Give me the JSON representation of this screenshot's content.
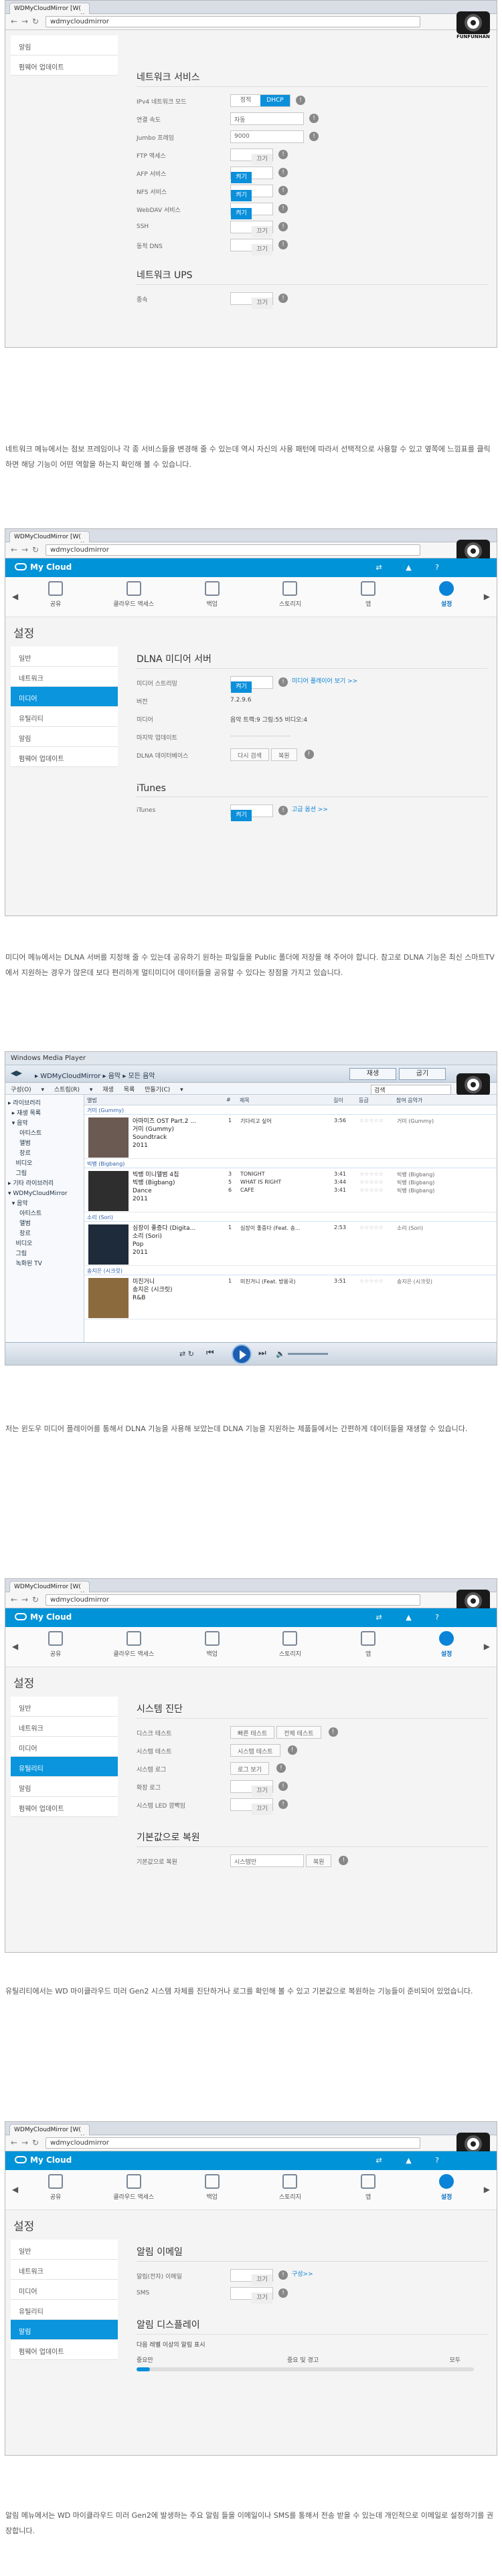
{
  "browser": {
    "tab_title": "WDMyCloudMirror [W(",
    "tab_title_full": "WDMyCloudMirror",
    "url": "wdmycloudmirror",
    "camera_brand": "FUNFUNHAN"
  },
  "shot1": {
    "sidebar": [
      "알림",
      "펌웨어 업데이트"
    ],
    "section_title": "네트워크 서비스",
    "rows": [
      {
        "label": "IPv4 네트워크 모드",
        "type": "seg",
        "a": "정적",
        "b": "DHCP"
      },
      {
        "label": "연결 속도",
        "type": "select",
        "value": "자동"
      },
      {
        "label": "Jumbo 프레임",
        "type": "select",
        "value": "9000"
      },
      {
        "label": "FTP 액세스",
        "type": "toggle",
        "state": "off"
      },
      {
        "label": "AFP 서비스",
        "type": "toggle",
        "state": "on"
      },
      {
        "label": "NFS 서비스",
        "type": "toggle",
        "state": "on"
      },
      {
        "label": "WebDAV 서비스",
        "type": "toggle",
        "state": "on"
      },
      {
        "label": "SSH",
        "type": "toggle",
        "state": "off"
      },
      {
        "label": "동적 DNS",
        "type": "toggle",
        "state": "off"
      }
    ],
    "ups_title": "네트워크 UPS",
    "ups_row": {
      "label": "종속",
      "state": "off"
    }
  },
  "toggle": {
    "on": "켜기",
    "off": "끄기"
  },
  "para1": "네트워크 메뉴에서는 점보 프레임이나 각 종 서비스들을 변경해 줄 수 있는데 역시 자신의 사용 패턴에 따라서 선택적으로 사용할 수 있고 옆쪽에 느낌표를 클릭하면 해당 기능이 어떤 역할을 하는지 확인해 볼 수 있습니다.",
  "wd": {
    "logo": "My Cloud",
    "nav": [
      "공유",
      "클라우드 액세스",
      "백업",
      "스토리지",
      "앱",
      "설정"
    ],
    "page_title": "설정",
    "sidebar": [
      "일반",
      "네트워크",
      "미디어",
      "유틸리티",
      "알림",
      "펌웨어 업데이트"
    ]
  },
  "shot2": {
    "section_title": "DLNA 미디어 서버",
    "rows": [
      {
        "label": "미디어 스트리밍",
        "kind": "toggle_link",
        "link": "미디어 플레이어 보기 >>"
      },
      {
        "label": "버전",
        "kind": "text",
        "value": "7.2.9.6"
      },
      {
        "label": "미디어",
        "kind": "text",
        "value": "음악 트랙:9   그림:55   비디오:4"
      },
      {
        "label": "마지막 업데이트",
        "kind": "text",
        "value": "——————————"
      },
      {
        "label": "DLNA 데이터베이스",
        "kind": "buttons",
        "b1": "다시 검색",
        "b2": "복원"
      }
    ],
    "itunes_title": "iTunes",
    "itunes_row": {
      "label": "iTunes",
      "link": "고급 옵션 >>"
    }
  },
  "para2": "미디어 메뉴에서는 DLNA 서버를 지정해 줄 수 있는데 공유하기 원하는 파일들을 Public 폴더에 저장을 해 주어야 합니다. 참고로 DLNA 기능은 최신 스마트TV에서 지원하는 경우가 많은데 보다 편리하게 멀티미디어 데이터들을 공유할 수 있다는 장점을 가지고 있습니다.",
  "wmp": {
    "title": "Windows Media Player",
    "breadcrumb": "▸ WDMyCloudMirror ▸ 음악 ▸ 모든 음악",
    "btn_play": "재생",
    "btn_sync": "굽기",
    "menu": "구성(O) ▾  스트림(R) ▾  재생 목록 만들기(C) ▾",
    "search": "검색",
    "tree": [
      "▸ 라이브러리",
      "  ▸ 재생 목록",
      "  ▾ 음악",
      "      아티스트",
      "      앨범",
      "      장르",
      "    비디오",
      "    그림",
      "▸ 기타 라이브러리",
      "▾ WDMyCloudMirror",
      "  ▾ 음악",
      "      아티스트",
      "      앨범",
      "      장르",
      "    비디오",
      "    그림",
      "    녹화된 TV"
    ],
    "cols": [
      "앨범",
      "#",
      "제목",
      "길이",
      "등급",
      "참여 음악가"
    ],
    "groups": [
      {
        "head": "거미 (Gummy)",
        "meta": [
          "아마미즈 OST Part.2 ...",
          "거미 (Gummy)",
          "Soundtrack",
          "2011"
        ],
        "tracks": [
          {
            "n": "1",
            "t": "기다리고 싶어",
            "len": "3:56",
            "art": "거미 (Gummy)"
          }
        ]
      },
      {
        "head": "빅뱅 (Bigbang)",
        "meta": [
          "빅뱅 미니앨범 4집",
          "빅뱅 (Bigbang)",
          "Dance",
          "2011"
        ],
        "tracks": [
          {
            "n": "3",
            "t": "TONIGHT",
            "len": "3:41",
            "art": "빅뱅 (Bigbang)"
          },
          {
            "n": "5",
            "t": "WHAT IS RIGHT",
            "len": "3:44",
            "art": "빅뱅 (Bigbang)"
          },
          {
            "n": "6",
            "t": "CAFE",
            "len": "3:41",
            "art": "빅뱅 (Bigbang)"
          }
        ]
      },
      {
        "head": "소리 (Sori)",
        "meta": [
          "심장이 좋증다 (Digita...",
          "소리 (Sori)",
          "Pop",
          "2011"
        ],
        "tracks": [
          {
            "n": "1",
            "t": "심장이 좋증다 (Feat. 송...",
            "len": "2:53",
            "art": "소리 (Sori)"
          }
        ]
      },
      {
        "head": "송지은 (시크릿)",
        "meta": [
          "미친거니",
          "송지은 (시크릿)",
          "R&B",
          ""
        ],
        "tracks": [
          {
            "n": "1",
            "t": "미친거니 (Feat. 방용국)",
            "len": "3:51",
            "art": "송지은 (시크릿)"
          }
        ]
      }
    ]
  },
  "para3": "저는 윈도우 미디어 플레이어를 통해서 DLNA 기능을 사용해 보았는데 DLNA 기능을 지원하는 제품들에서는 간편하게 데이터들을 재생할 수 있습니다.",
  "shot3": {
    "section_title": "시스템 진단",
    "rows": [
      {
        "label": "디스크 테스트",
        "b": [
          "빠른 테스트",
          "전체 테스트"
        ]
      },
      {
        "label": "시스템 테스트",
        "b": [
          "시스템 테스트"
        ]
      },
      {
        "label": "시스템 로그",
        "b": [
          "로그 보기"
        ]
      },
      {
        "label": "확장 로그",
        "t": true
      },
      {
        "label": "시스템 LED 깜빡임",
        "t": true
      }
    ],
    "restore_title": "기본값으로 복원",
    "restore_label": "기본값으로 복원",
    "restore_select": "시스템만",
    "restore_btn": "복원"
  },
  "para4": "유틸리티에서는 WD 마이클라우드 미러 Gen2 시스템 자체를 진단하거나 로그를 확인해 볼 수 있고 기본값으로 복원하는 기능들이 준비되어 있었습니다.",
  "shot4": {
    "section_title": "알림 이메일",
    "rows": [
      {
        "label": "알림(전자) 이메일",
        "link": "구성>>"
      },
      {
        "label": "SMS"
      }
    ],
    "display_title": "알림 디스플레이",
    "display_desc": "다음 레벨 이상의 알림 표시",
    "levels": [
      "중요만",
      "중요 및 경고",
      "모두"
    ]
  },
  "para5": "알림 메뉴에서는 WD 마이클라우드 미러 Gen2에 발생하는 주요 알림 들을 이메일이나 SMS를 통해서 전송 받을 수 있는데 개인적으로 이메일로 설정하기를 권장합니다."
}
